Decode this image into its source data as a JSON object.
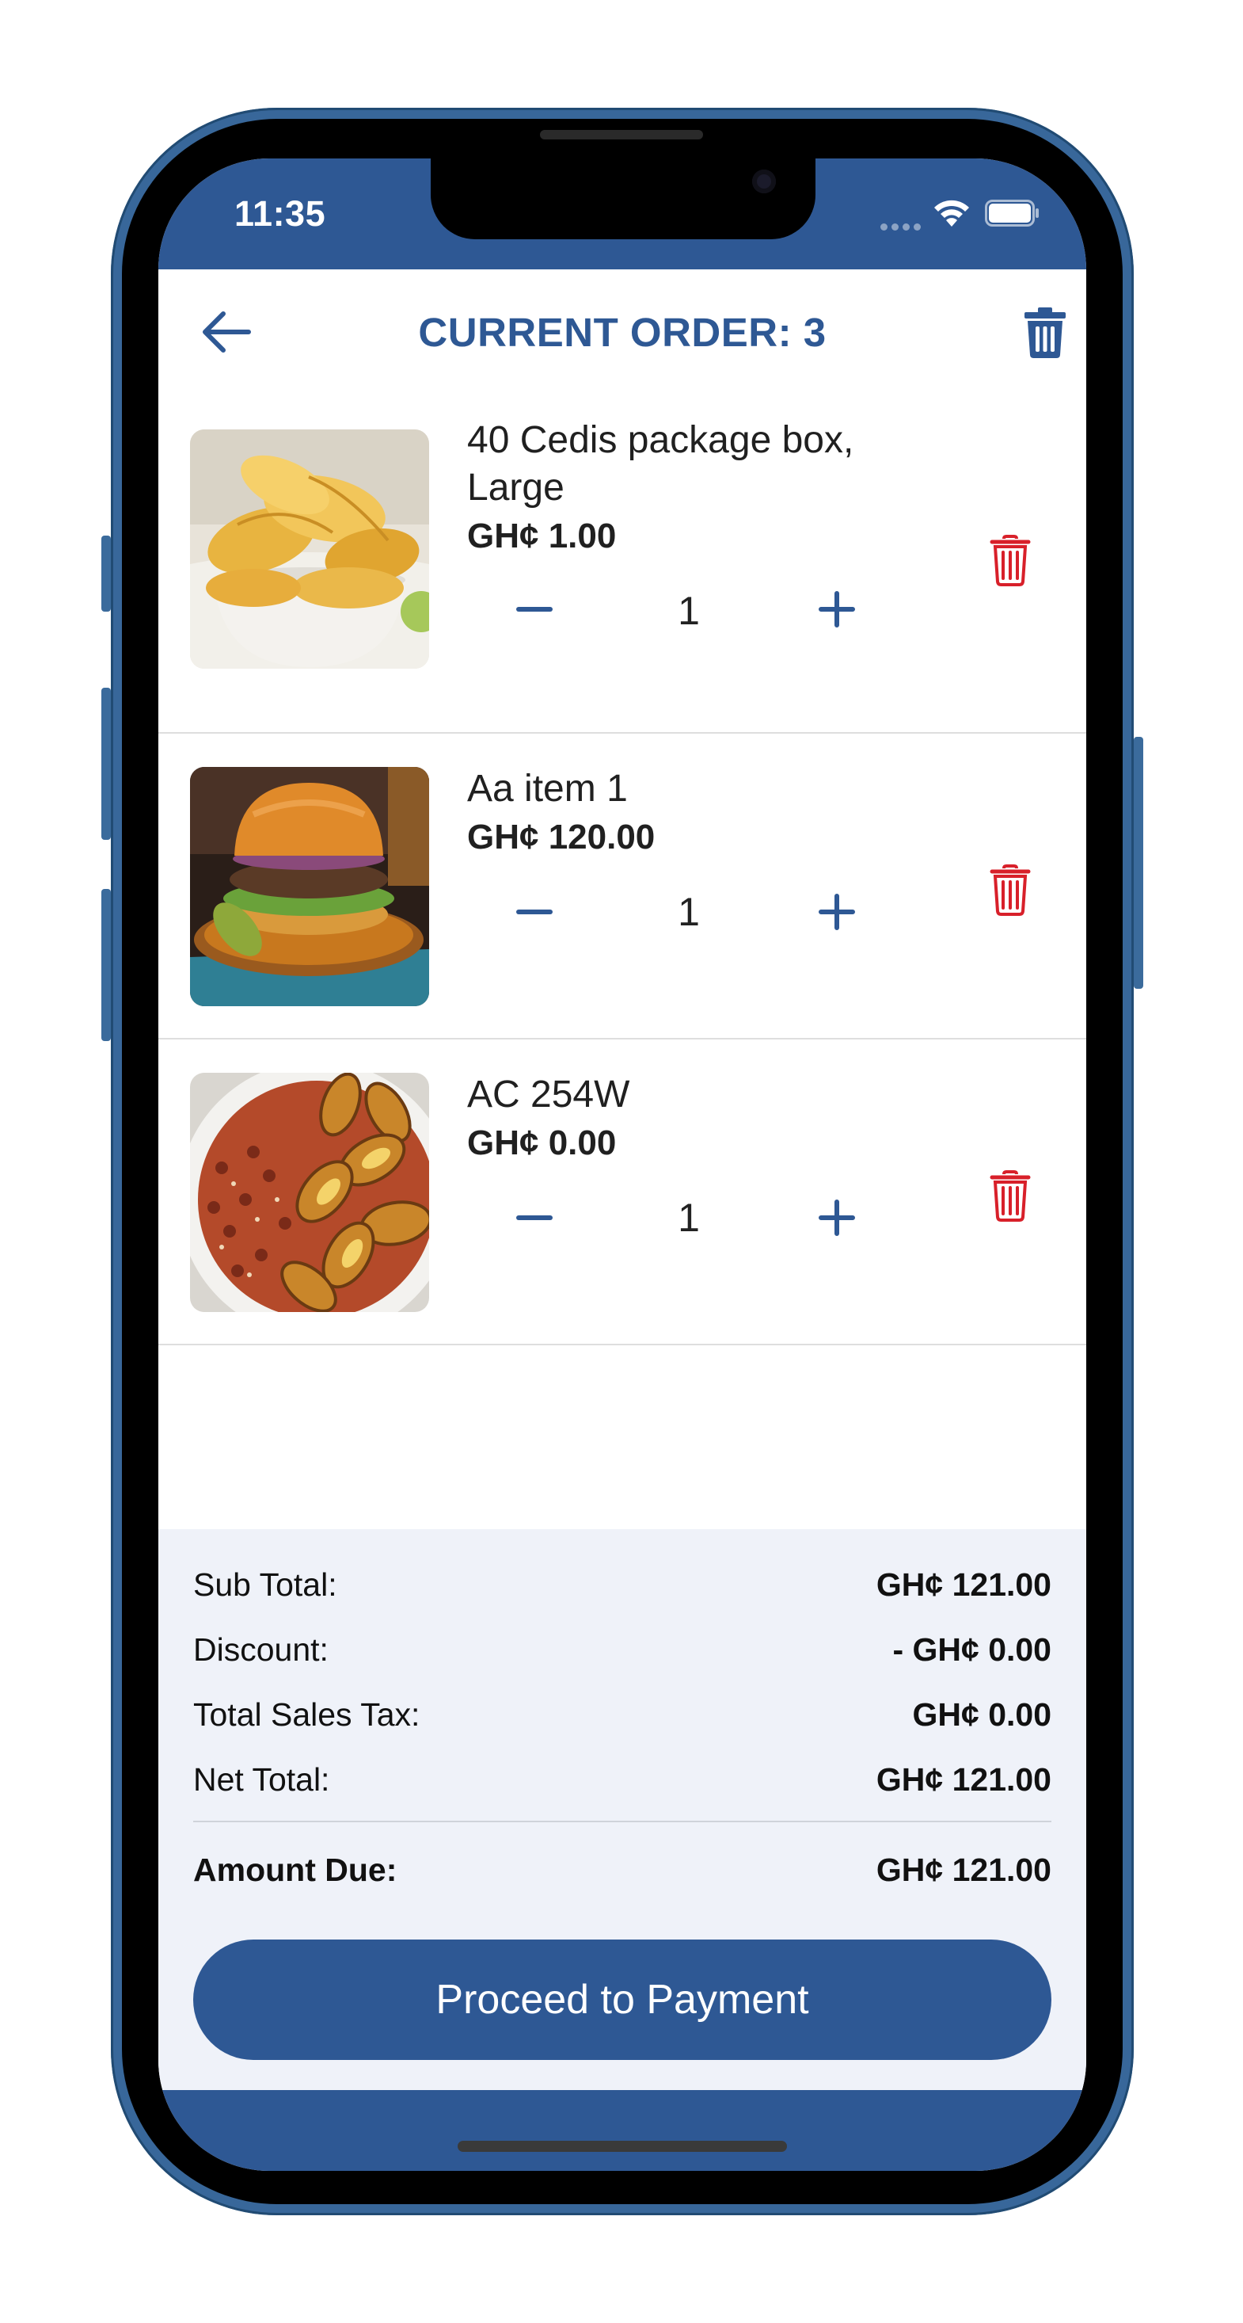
{
  "status_bar": {
    "time": "11:35"
  },
  "header": {
    "title": "CURRENT ORDER: 3"
  },
  "items": [
    {
      "name": "40 Cedis package box, Large",
      "price": "GH¢ 1.00",
      "quantity": "1",
      "image": "bowl-of-crisps"
    },
    {
      "name": "Aa item 1",
      "price": "GH¢ 120.00",
      "quantity": "1",
      "image": "burger"
    },
    {
      "name": "AC 254W",
      "price": "GH¢ 0.00",
      "quantity": "1",
      "image": "beans-and-plantain"
    }
  ],
  "summary": {
    "sub_total_label": "Sub Total:",
    "sub_total_value": "GH¢ 121.00",
    "discount_label": "Discount:",
    "discount_value": "- GH¢ 0.00",
    "tax_label": "Total Sales Tax:",
    "tax_value": "GH¢ 0.00",
    "net_total_label": "Net Total:",
    "net_total_value": "GH¢ 121.00",
    "amount_due_label": "Amount Due:",
    "amount_due_value": "GH¢ 121.00"
  },
  "actions": {
    "proceed_label": "Proceed to Payment"
  },
  "colors": {
    "brand": "#2e5894",
    "delete": "#d8202a",
    "summary_bg": "#eff2f9"
  }
}
